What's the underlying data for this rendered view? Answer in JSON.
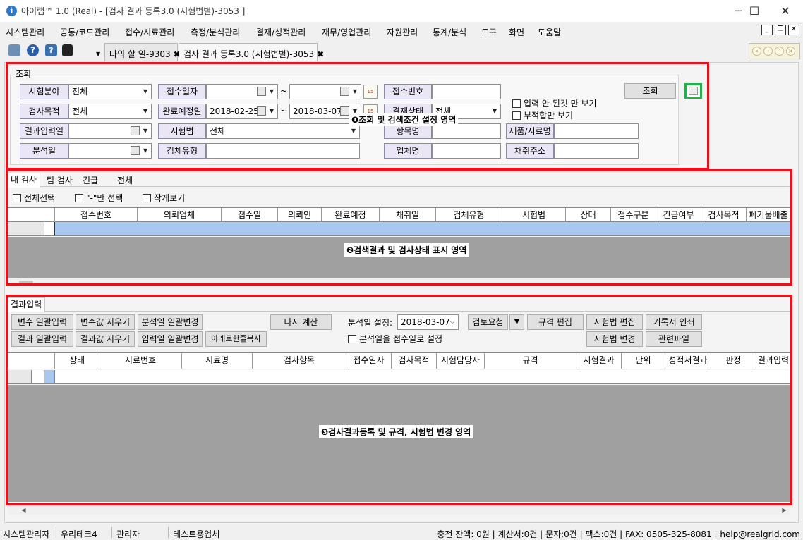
{
  "window": {
    "title": "아이랩™ 1.0 (Real) - [검사 결과 등록3.0 (시험법별)-3053 ]",
    "minimize": "─",
    "maximize": "☐",
    "close": "✕"
  },
  "menu": [
    "시스템관리",
    "공통/코드관리",
    "접수/시료관리",
    "측정/분석관리",
    "결재/성적관리",
    "재무/영업관리",
    "자원관리",
    "통계/분석",
    "도구",
    "화면",
    "도움말"
  ],
  "doc_tabs": [
    {
      "label": "나의 할 일-9303",
      "close": "✖"
    },
    {
      "label": "검사 결과 등록3.0 (시험법별)-3053",
      "close": "✖"
    }
  ],
  "search": {
    "group_title": "조회",
    "labels": {
      "test_field": "시험분야",
      "test_purpose": "검사목적",
      "result_input_date": "결과입력일",
      "analysis_date": "분석일",
      "receipt_date": "접수일자",
      "due_date": "완료예정일",
      "test_method": "시험법",
      "specimen_type": "검체유형",
      "receipt_no": "접수번호",
      "approval_status": "결재상태",
      "item_name": "항목명",
      "company_name": "업체명",
      "product_name": "제품/시료명",
      "sampling_address": "채취주소"
    },
    "values": {
      "test_field": "전체",
      "test_purpose": "전체",
      "approval_status": "전체",
      "test_method": "전체",
      "due_from": "2018-02-25",
      "due_to": "2018-03-07"
    },
    "tilde": "~",
    "calendar_icon": "15",
    "search_button": "조회",
    "collapse_button": "－",
    "check_not_entered": "입력 안 된것 만 보기",
    "check_nonconforming": "부적합만 보기",
    "overlay": "❶조회 및 검색조건 설정 영역"
  },
  "list": {
    "tabs": [
      "내 검사",
      "팀 검사",
      "긴급",
      "전체"
    ],
    "check_all": "전체선택",
    "check_dash": "\"-\"만 선택",
    "check_small": "작게보기",
    "columns": [
      "접수번호",
      "의뢰업체",
      "접수일",
      "의뢰인",
      "완료예정",
      "채취일",
      "검체유형",
      "시험법",
      "상태",
      "접수구분",
      "긴급여부",
      "검사목적",
      "폐기물배출"
    ],
    "overlay": "❷검색결과 및 검사상태 표시 영역"
  },
  "result": {
    "tab": "결과입력",
    "buttons": {
      "var_batch": "변수 일괄입력",
      "var_clear": "변수값 지우기",
      "analysis_date_batch": "분석일 일괄변경",
      "result_batch": "결과 일괄입력",
      "result_clear": "결과값 지우기",
      "input_date_batch": "입력일 일괄변경",
      "copy_down": "아래로한줄복사",
      "recalc": "다시 계산",
      "review_request": "검토요청",
      "spec_edit": "규격 편집",
      "method_edit": "시험법 편집",
      "record_print": "기록서 인쇄",
      "method_change": "시험법 변경",
      "related_files": "관련파일"
    },
    "analysis_date_label": "분석일 설정:",
    "analysis_date_value": "2018-03-07",
    "check_same_as_receipt": "분석일을 접수일로 설정",
    "columns": [
      "상태",
      "시료번호",
      "시료명",
      "검사항목",
      "접수일자",
      "검사목적",
      "시험담당자",
      "규격",
      "시험결과",
      "단위",
      "성적서결과",
      "판정",
      "결과입력"
    ],
    "overlay": "❸검사결과등록 및 규격, 시험법 변경 영역"
  },
  "status": {
    "user": "시스템관리자",
    "company": "우리테크4",
    "role": "관리자",
    "test_company": "테스트용업체",
    "info": "충전 잔액: 0원 | 계산서:0건 | 문자:0건 | 팩스:0건 | FAX: 0505-325-8081 | help@realgrid.com"
  },
  "colors": {
    "highlight_red": "#e8121d",
    "collapse_green": "#22b14c",
    "label_bg": "#ebe6f6",
    "grid_grey": "#a0a0a0",
    "selected_row": "#a9c8f0"
  }
}
